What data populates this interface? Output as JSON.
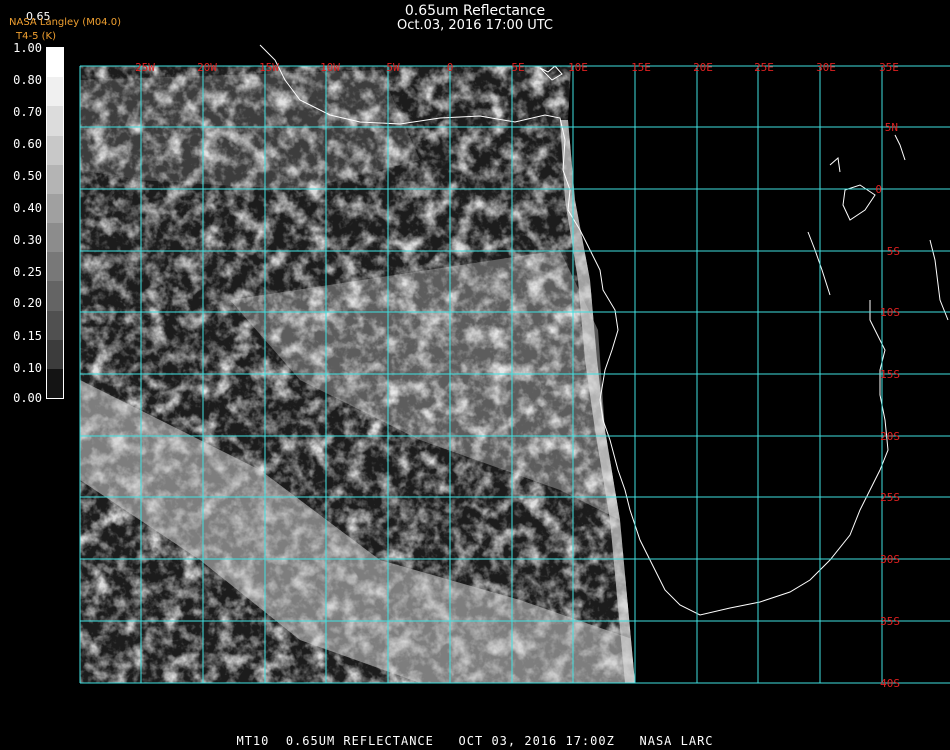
{
  "header": {
    "title": "0.65um Reflectance",
    "subtitle": "Oct.03, 2016 17:00 UTC",
    "credit_org": "NASA Langley (M04.0)",
    "credit_var": "T4-5 (K)",
    "scale_top": "0.65"
  },
  "colorbar": {
    "labels": [
      "1.00",
      "0.80",
      "0.70",
      "0.60",
      "0.50",
      "0.40",
      "0.30",
      "0.25",
      "0.20",
      "0.15",
      "0.10",
      "0.00"
    ],
    "shades": [
      "#ffffff",
      "#f0f0f0",
      "#dcdcdc",
      "#c8c8c8",
      "#b4b4b4",
      "#a0a0a0",
      "#8c8c8c",
      "#787878",
      "#646464",
      "#505050",
      "#3c3c3c",
      "#141414"
    ]
  },
  "map": {
    "lon_labels": [
      "25W",
      "20W",
      "15W",
      "10W",
      "5W",
      "0",
      "5E",
      "10E",
      "15E",
      "20E",
      "25E",
      "30E",
      "35E"
    ],
    "lat_labels": [
      "5N",
      "0",
      "5S",
      "10S",
      "15S",
      "20S",
      "25S",
      "30S",
      "35S",
      "40S"
    ],
    "grid_color": "#40e0e0",
    "label_color": "#e02020",
    "coast_color": "#ffffff",
    "scene": {
      "overall_cloud_fraction": 0.45,
      "ocean_reflectance": 0.05,
      "stratocumulus_deck_reflectance": 0.4,
      "frontal_cloud_band_reflectance": 0.8
    }
  },
  "footer": {
    "text": "MT10  0.65UM REFLECTANCE   OCT 03, 2016 17:00Z   NASA LARC"
  }
}
